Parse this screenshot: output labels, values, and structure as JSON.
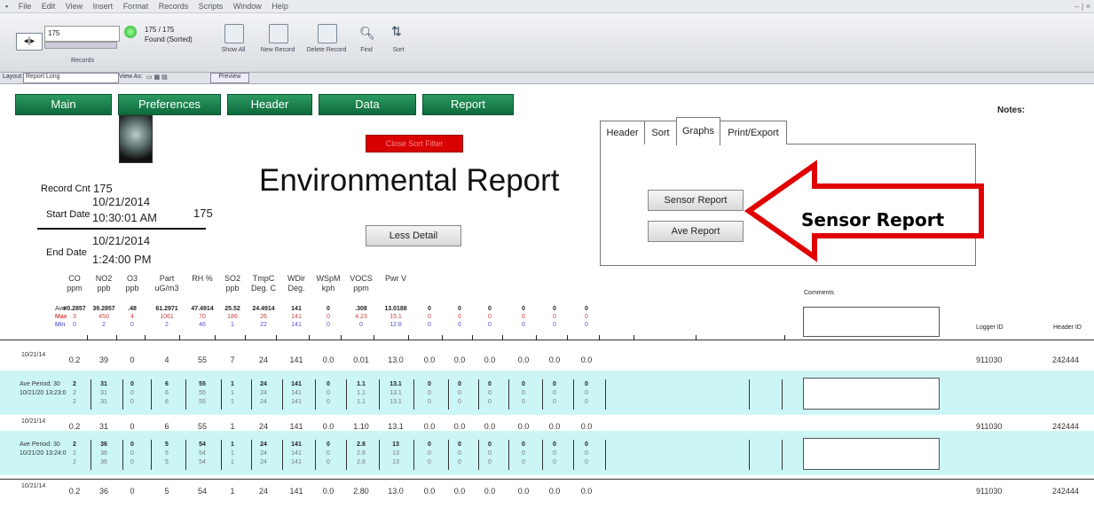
{
  "menu": [
    "File",
    "Edit",
    "View",
    "Insert",
    "Format",
    "Records",
    "Scripts",
    "Window",
    "Help"
  ],
  "toolbar": {
    "record_number": "175",
    "record_count": "175 / 175",
    "found_status": "Found (Sorted)",
    "records_label": "Records",
    "show_all": "Show All",
    "new_record": "New Record",
    "delete_record": "Delete Record",
    "find": "Find",
    "sort": "Sort"
  },
  "layout_bar": {
    "layout_label": "Layout:",
    "layout_value": "Report Long",
    "view_as": "View As:",
    "preview": "Preview"
  },
  "nav_tabs": [
    "Main",
    "Preferences",
    "Header",
    "Data",
    "Report"
  ],
  "notes_label": "Notes:",
  "red_button": "Close Sort Filter",
  "title": "Environmental Report",
  "record_cnt": {
    "label": "Record Cnt",
    "value": "175"
  },
  "start_date": {
    "label": "Start Date",
    "date": "10/21/2014",
    "time": "10:30:01 AM"
  },
  "side_count": "175",
  "end_date": {
    "label": "End Date",
    "date": "10/21/2014",
    "time": "1:24:00 PM"
  },
  "less_detail": "Less Detail",
  "panel_tabs": [
    "Header",
    "Sort",
    "Graphs",
    "Print/Export"
  ],
  "panel_buttons": {
    "sensor": "Sensor Report",
    "ave": "Ave Report"
  },
  "callout": "Sensor Report",
  "columns": [
    {
      "l1": "CO",
      "l2": "ppm"
    },
    {
      "l1": "NO2",
      "l2": "ppb"
    },
    {
      "l1": "O3",
      "l2": "ppb"
    },
    {
      "l1": "Part",
      "l2": "uG/m3"
    },
    {
      "l1": "RH %",
      "l2": ""
    },
    {
      "l1": "SO2",
      "l2": "ppb"
    },
    {
      "l1": "TmpC",
      "l2": "Deg. C"
    },
    {
      "l1": "WDir",
      "l2": "Deg."
    },
    {
      "l1": "WSpM",
      "l2": "kph"
    },
    {
      "l1": "VOCS",
      "l2": "ppm"
    },
    {
      "l1": "Pwr V",
      "l2": ""
    }
  ],
  "summary_labels": [
    "Ave",
    "Max",
    "Min"
  ],
  "summary": {
    "ave": [
      "#0.2857",
      "39.2857",
      ".48",
      "61.2971",
      "47.4914",
      "25.52",
      "24.4914",
      "141",
      "0",
      ".308",
      "13.0188",
      "0",
      "0",
      "0",
      "0",
      "0",
      "0"
    ],
    "max": [
      "3",
      "450",
      "4",
      "1061",
      "70",
      "186",
      "26",
      "141",
      "0",
      "4.23",
      "15.1",
      "0",
      "0",
      "0",
      "0",
      "0",
      "0"
    ],
    "min": [
      "0",
      "2",
      "0",
      "2",
      "46",
      "1",
      "22",
      "141",
      "0",
      "0",
      "12.8",
      "0",
      "0",
      "0",
      "0",
      "0",
      "0"
    ]
  },
  "comments_label": "Comments",
  "logger_id_label": "Logger ID",
  "header_id_label": "Header ID",
  "rows": [
    {
      "date": "10/21/14",
      "values": [
        "0.2",
        "39",
        "0",
        "4",
        "55",
        "7",
        "24",
        "141",
        "0.0",
        "0.01",
        "13.0",
        "0.0",
        "0.0",
        "0.0",
        "0.0",
        "0.0",
        "0.0"
      ],
      "logger": "911030",
      "header": "242444"
    },
    {
      "date": "10/21/14",
      "values": [
        "0.2",
        "31",
        "0",
        "6",
        "55",
        "1",
        "24",
        "141",
        "0.0",
        "1.10",
        "13.1",
        "0.0",
        "0.0",
        "0.0",
        "0.0",
        "0.0",
        "0.0"
      ],
      "logger": "911030",
      "header": "242444"
    },
    {
      "date": "10/21/14",
      "values": [
        "0.2",
        "36",
        "0",
        "5",
        "54",
        "1",
        "24",
        "141",
        "0.0",
        "2.80",
        "13.0",
        "0.0",
        "0.0",
        "0.0",
        "0.0",
        "0.0",
        "0.0"
      ],
      "logger": "911030",
      "header": "242444"
    }
  ],
  "ave_periods": [
    {
      "label1": "Ave Period: 30",
      "label2": "10/21/20 13:23:0",
      "ave": [
        "2",
        "31",
        "0",
        "6",
        "55",
        "1",
        "24",
        "141",
        "0",
        "1.1",
        "13.1",
        "0",
        "0",
        "0",
        "0",
        "0",
        "0"
      ],
      "max": [
        "2",
        "31",
        "0",
        "6",
        "55",
        "1",
        "24",
        "141",
        "0",
        "1.1",
        "13.1",
        "0",
        "0",
        "0",
        "0",
        "0",
        "0"
      ],
      "min": [
        "2",
        "31",
        "0",
        "6",
        "55",
        "1",
        "24",
        "141",
        "0",
        "1.1",
        "13.1",
        "0",
        "0",
        "0",
        "0",
        "0",
        "0"
      ]
    },
    {
      "label1": "Ave Period: 30",
      "label2": "10/21/20 13:24:0",
      "ave": [
        "2",
        "36",
        "0",
        "5",
        "54",
        "1",
        "24",
        "141",
        "0",
        "2.8",
        "13",
        "0",
        "0",
        "0",
        "0",
        "0",
        "0"
      ],
      "max": [
        "2",
        "36",
        "0",
        "5",
        "54",
        "1",
        "24",
        "141",
        "0",
        "2.8",
        "13",
        "0",
        "0",
        "0",
        "0",
        "0",
        "0"
      ],
      "min": [
        "2",
        "36",
        "0",
        "5",
        "54",
        "1",
        "24",
        "141",
        "0",
        "2.8",
        "13",
        "0",
        "0",
        "0",
        "0",
        "0",
        "0"
      ]
    }
  ],
  "colors": {
    "green_tab": "#157a46",
    "red_button": "#d80000",
    "callout_red": "#e00000",
    "row_band": "#ccf6f6"
  }
}
